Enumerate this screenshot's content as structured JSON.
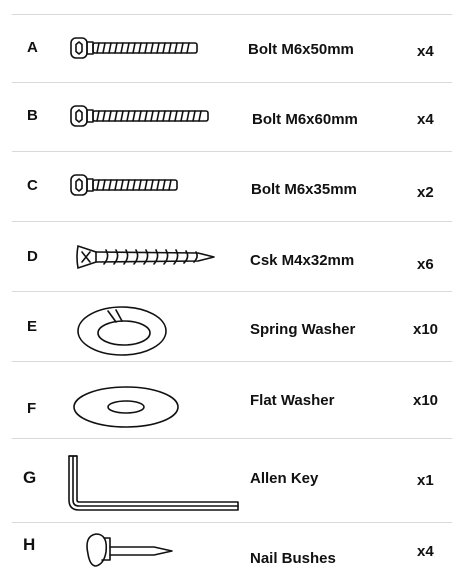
{
  "parts": [
    {
      "letter": "A",
      "name": "Bolt M6x50mm",
      "qty": "x4",
      "icon": "hex-socket-bolt-icon"
    },
    {
      "letter": "B",
      "name": "Bolt M6x60mm",
      "qty": "x4",
      "icon": "hex-socket-bolt-icon"
    },
    {
      "letter": "C",
      "name": "Bolt M6x35mm",
      "qty": "x2",
      "icon": "hex-socket-bolt-icon"
    },
    {
      "letter": "D",
      "name": "Csk M4x32mm",
      "qty": "x6",
      "icon": "countersunk-screw-icon"
    },
    {
      "letter": "E",
      "name": "Spring Washer",
      "qty": "x10",
      "icon": "spring-washer-icon"
    },
    {
      "letter": "F",
      "name": "Flat Washer",
      "qty": "x10",
      "icon": "flat-washer-icon"
    },
    {
      "letter": "G",
      "name": "Allen Key",
      "qty": "x1",
      "icon": "allen-key-icon"
    },
    {
      "letter": "H",
      "name": "Nail Bushes",
      "qty": "x4",
      "icon": "nail-bush-icon"
    }
  ]
}
